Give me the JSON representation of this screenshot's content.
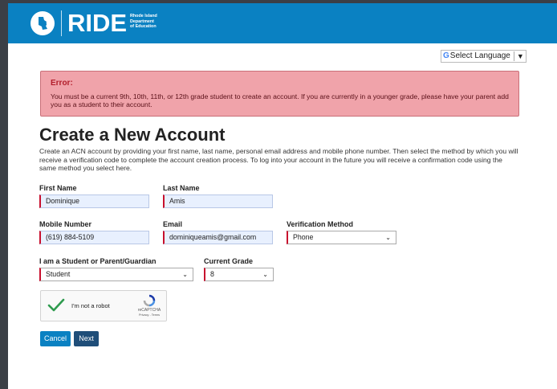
{
  "header": {
    "logo_text": "RIDE",
    "logo_sub_line1": "Rhode Island",
    "logo_sub_line2": "Department",
    "logo_sub_line3": "of Education",
    "bg_color": "#0a81c2"
  },
  "language": {
    "g_glyph": "G",
    "label": "Select Language",
    "arrow": "▼"
  },
  "alert": {
    "title": "Error:",
    "message": "You must be a current 9th, 10th, 11th, or 12th grade student to create an account. If you are currently in a younger grade, please have your parent add you as a student to their account.",
    "bg_color": "#f0a3aa"
  },
  "page": {
    "title": "Create a New Account",
    "description": "Create an ACN account by providing your first name, last name, personal email address and mobile phone number. Then select the method by which you will receive a verification code to complete the account creation process. To log into your account in the future you will receive a confirmation code using the same method you select here."
  },
  "form": {
    "first_name": {
      "label": "First Name",
      "value": "Dominique"
    },
    "last_name": {
      "label": "Last Name",
      "value": "Amis"
    },
    "mobile": {
      "label": "Mobile Number",
      "value": "(619) 884-5109"
    },
    "email": {
      "label": "Email",
      "value": "dominiqueamis@gmail.com"
    },
    "verification": {
      "label": "Verification Method",
      "value": "Phone"
    },
    "role": {
      "label": "I am a Student or Parent/Guardian",
      "value": "Student"
    },
    "grade": {
      "label": "Current Grade",
      "value": "8"
    }
  },
  "captcha": {
    "label": "I'm not a robot",
    "brand": "reCAPTCHA",
    "links": "Privacy - Terms",
    "checked": true
  },
  "buttons": {
    "cancel": "Cancel",
    "next": "Next"
  }
}
